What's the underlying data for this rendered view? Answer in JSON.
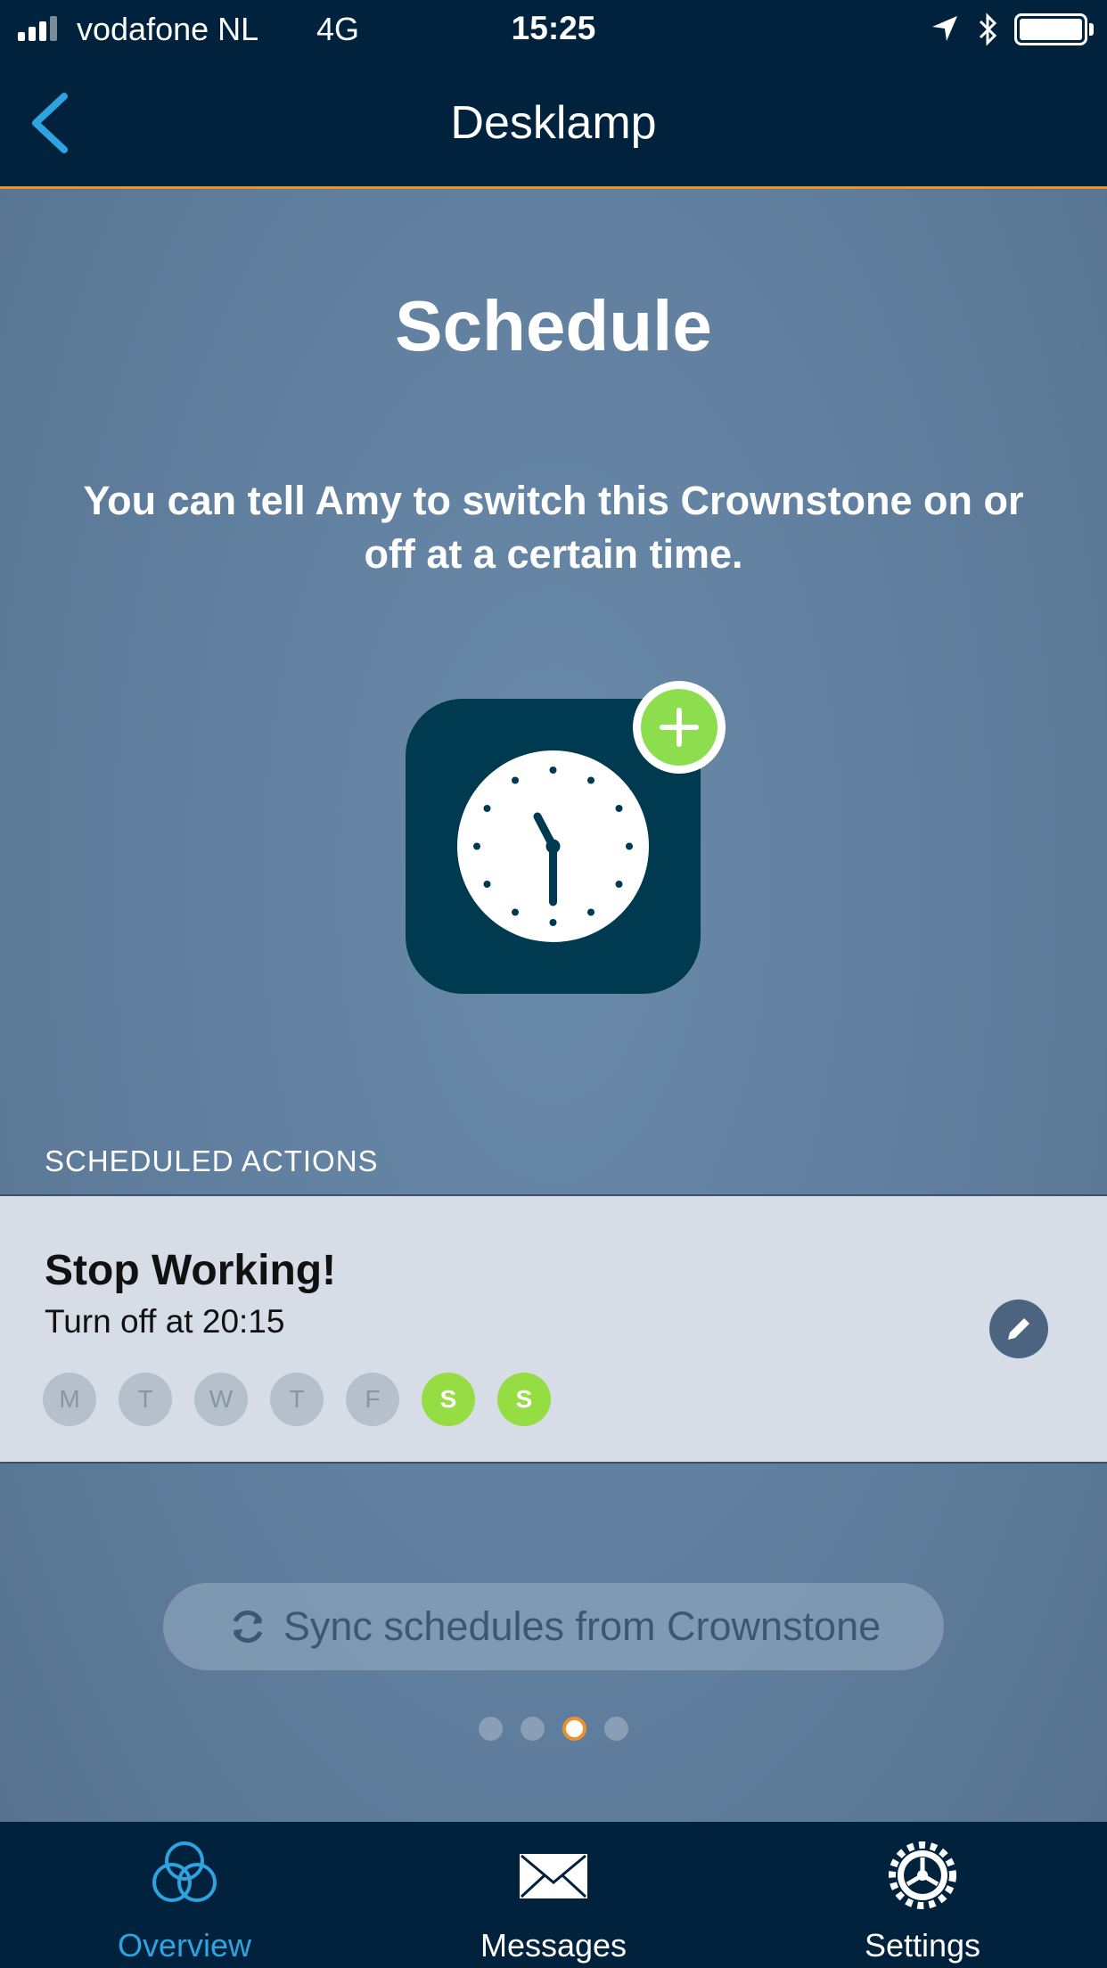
{
  "status_bar": {
    "carrier": "vodafone NL",
    "network": "4G",
    "time": "15:25"
  },
  "nav": {
    "title": "Desklamp"
  },
  "main": {
    "title": "Schedule",
    "description": "You can tell Amy to switch this Crownstone on or off at a certain time."
  },
  "section": {
    "header": "SCHEDULED ACTIONS"
  },
  "schedule": {
    "title": "Stop Working!",
    "subtitle": "Turn off at 20:15",
    "days": [
      {
        "label": "M",
        "active": false
      },
      {
        "label": "T",
        "active": false
      },
      {
        "label": "W",
        "active": false
      },
      {
        "label": "T",
        "active": false
      },
      {
        "label": "F",
        "active": false
      },
      {
        "label": "S",
        "active": true
      },
      {
        "label": "S",
        "active": true
      }
    ]
  },
  "sync": {
    "label": "Sync schedules from Crownstone"
  },
  "pager": {
    "count": 4,
    "active_index": 2
  },
  "tabs": [
    {
      "label": "Overview",
      "icon": "overview-icon",
      "active": true
    },
    {
      "label": "Messages",
      "icon": "envelope-icon",
      "active": false
    },
    {
      "label": "Settings",
      "icon": "gear-icon",
      "active": false
    }
  ],
  "colors": {
    "accent": "#e9922e",
    "active_tab": "#2da4e0",
    "day_active": "#96dd44",
    "nav_bg": "#00223d"
  }
}
